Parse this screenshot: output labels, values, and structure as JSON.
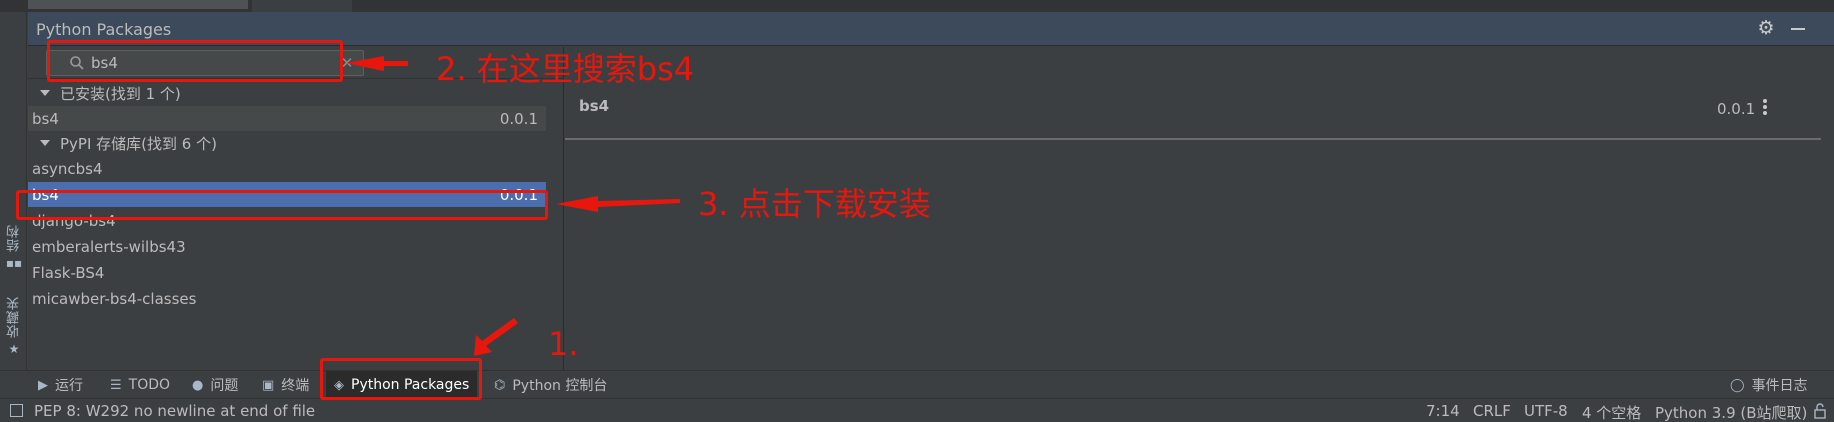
{
  "panel": {
    "title": "Python Packages"
  },
  "search": {
    "value": "bs4",
    "placeholder": ""
  },
  "installed_group": {
    "label": "已安装(找到 1 个)",
    "items": [
      {
        "name": "bs4",
        "version": "0.0.1"
      }
    ]
  },
  "pypi_group": {
    "label": "PyPI 存储库(找到 6 个)",
    "items": [
      {
        "name": "asyncbs4",
        "version": ""
      },
      {
        "name": "bs4",
        "version": "0.0.1"
      },
      {
        "name": "django-bs4",
        "version": ""
      },
      {
        "name": "emberalerts-wilbs43",
        "version": ""
      },
      {
        "name": "Flask-BS4",
        "version": ""
      },
      {
        "name": "micawber-bs4-classes",
        "version": ""
      }
    ],
    "selected_index": 1
  },
  "details": {
    "name": "bs4",
    "version": "0.0.1"
  },
  "left_strip": {
    "structure_label": "结构",
    "favorites_label": "收藏夹"
  },
  "tool_tabs": [
    {
      "label": "运行",
      "icon": "play-icon"
    },
    {
      "label": "TODO",
      "icon": "list-icon"
    },
    {
      "label": "问题",
      "icon": "problems-icon"
    },
    {
      "label": "终端",
      "icon": "terminal-icon"
    },
    {
      "label": "Python Packages",
      "icon": "packages-icon",
      "active": true
    },
    {
      "label": "Python 控制台",
      "icon": "python-console-icon"
    },
    {
      "label": "事件日志",
      "icon": "event-log-icon"
    }
  ],
  "status_bar": {
    "message": "PEP 8: W292 no newline at end of file",
    "position": "7:14",
    "line_separator": "CRLF",
    "encoding": "UTF-8",
    "indent": "4 个空格",
    "interpreter": "Python 3.9 (B站爬取)"
  },
  "annotations": {
    "step1": "1.",
    "step2": "2. 在这里搜索bs4",
    "step3": "3. 点击下载安装",
    "color": "#e8170d"
  },
  "colors": {
    "selection": "#4b6eaf",
    "panel_header": "#3d4a5b",
    "background": "#3c3f41"
  }
}
